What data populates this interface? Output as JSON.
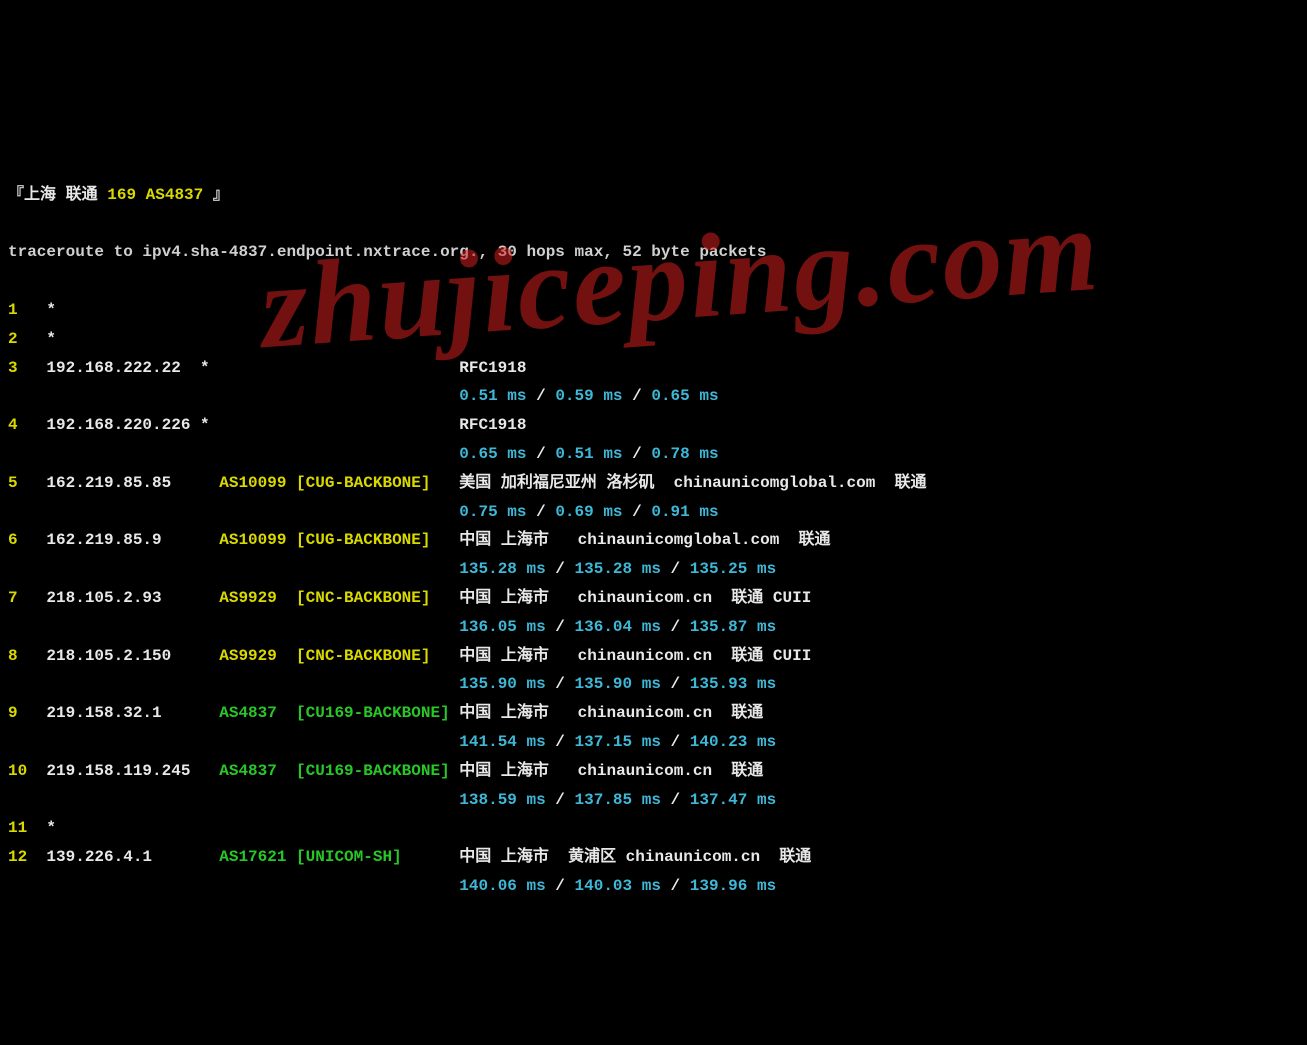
{
  "header": {
    "bracket_open": "『",
    "loc_label": "上海 联通",
    "asn_label": "169 AS4837",
    "bracket_close": " 』"
  },
  "cmd_line": "traceroute to ipv4.sha-4837.endpoint.nxtrace.org., 30 hops max, 52 byte packets",
  "watermark": "zhujiceping.com",
  "hops": [
    {
      "n": "1",
      "ip": "*",
      "flag": "",
      "asn": "",
      "asn_color": "",
      "net": "",
      "net_color": "",
      "desc": "",
      "lat": ""
    },
    {
      "n": "2",
      "ip": "*",
      "flag": "",
      "asn": "",
      "asn_color": "",
      "net": "",
      "net_color": "",
      "desc": "",
      "lat": ""
    },
    {
      "n": "3",
      "ip": "192.168.222.22",
      "flag": "*",
      "asn": "",
      "asn_color": "",
      "net": "",
      "net_color": "",
      "desc": "RFC1918",
      "lat": "0.51 ms / 0.59 ms / 0.65 ms"
    },
    {
      "n": "4",
      "ip": "192.168.220.226",
      "flag": "*",
      "asn": "",
      "asn_color": "",
      "net": "",
      "net_color": "",
      "desc": "RFC1918",
      "lat": "0.65 ms / 0.51 ms / 0.78 ms"
    },
    {
      "n": "5",
      "ip": "162.219.85.85",
      "flag": "",
      "asn": "AS10099",
      "asn_color": "yellow",
      "net": "[CUG-BACKBONE]",
      "net_color": "yellow",
      "desc": "美国 加利福尼亚州 洛杉矶  chinaunicomglobal.com  联通",
      "lat": "0.75 ms / 0.69 ms / 0.91 ms"
    },
    {
      "n": "6",
      "ip": "162.219.85.9",
      "flag": "",
      "asn": "AS10099",
      "asn_color": "yellow",
      "net": "[CUG-BACKBONE]",
      "net_color": "yellow",
      "desc": "中国 上海市   chinaunicomglobal.com  联通",
      "lat": "135.28 ms / 135.28 ms / 135.25 ms"
    },
    {
      "n": "7",
      "ip": "218.105.2.93",
      "flag": "",
      "asn": "AS9929",
      "asn_color": "yellow",
      "net": "[CNC-BACKBONE]",
      "net_color": "yellow",
      "desc": "中国 上海市   chinaunicom.cn  联通 CUII",
      "lat": "136.05 ms / 136.04 ms / 135.87 ms"
    },
    {
      "n": "8",
      "ip": "218.105.2.150",
      "flag": "",
      "asn": "AS9929",
      "asn_color": "yellow",
      "net": "[CNC-BACKBONE]",
      "net_color": "yellow",
      "desc": "中国 上海市   chinaunicom.cn  联通 CUII",
      "lat": "135.90 ms / 135.90 ms / 135.93 ms"
    },
    {
      "n": "9",
      "ip": "219.158.32.1",
      "flag": "",
      "asn": "AS4837",
      "asn_color": "green",
      "net": "[CU169-BACKBONE]",
      "net_color": "green",
      "desc": "中国 上海市   chinaunicom.cn  联通",
      "lat": "141.54 ms / 137.15 ms / 140.23 ms"
    },
    {
      "n": "10",
      "ip": "219.158.119.245",
      "flag": "",
      "asn": "AS4837",
      "asn_color": "green",
      "net": "[CU169-BACKBONE]",
      "net_color": "green",
      "desc": "中国 上海市   chinaunicom.cn  联通",
      "lat": "138.59 ms / 137.85 ms / 137.47 ms"
    },
    {
      "n": "11",
      "ip": "*",
      "flag": "",
      "asn": "",
      "asn_color": "",
      "net": "",
      "net_color": "",
      "desc": "",
      "lat": ""
    },
    {
      "n": "12",
      "ip": "139.226.4.1",
      "flag": "",
      "asn": "AS17621",
      "asn_color": "green",
      "net": "[UNICOM-SH]",
      "net_color": "green",
      "desc": "中国 上海市  黄浦区 chinaunicom.cn  联通",
      "lat": "140.06 ms / 140.03 ms / 139.96 ms"
    }
  ]
}
